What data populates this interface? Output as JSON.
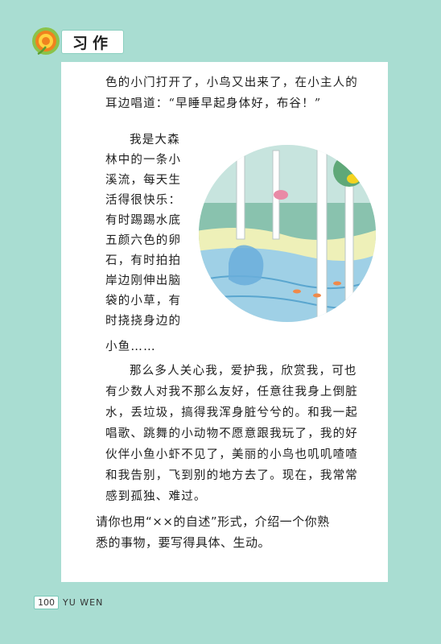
{
  "header": {
    "title": "习作"
  },
  "content": {
    "para1": [
      "色的小门打开了，小鸟又出来了，在小主人的",
      "耳边唱道：“早睡早起身体好，布谷！”"
    ],
    "wrap_lines": [
      "我是大森",
      "林中的一条小",
      "溪流，每天生",
      "活得很快乐：",
      "有时踢踢水底",
      "五颜六色的卵",
      "石，有时拍拍",
      "岸边刚伸出脑",
      "袋的小草，有",
      "时挠挠身边的",
      "小鱼……"
    ],
    "para3": [
      "那么多人关心我，爱护我，欣赏我，可也",
      "有少数人对我不那么友好，任意往我身上倒脏",
      "水，丢垃圾，搞得我浑身脏兮兮的。和我一起",
      "唱歌、跳舞的小动物不愿意跟我玩了，我的好",
      "伙伴小鱼小虾不见了，美丽的小鸟也叽叽喳喳",
      "和我告别，飞到别的地方去了。现在，我常常",
      "感到孤独、难过。"
    ],
    "prompt": [
      "请你也用“××的自述”形式，介绍一个你熟",
      "悉的事物，要写得具体、生动。"
    ]
  },
  "footer": {
    "page_number": "100",
    "book": "YU WEN"
  },
  "colors": {
    "background": "#a9ddd2",
    "page": "#ffffff",
    "accent": "#f0821e"
  },
  "icons": {
    "logo": "orange-flower-logo-icon"
  }
}
